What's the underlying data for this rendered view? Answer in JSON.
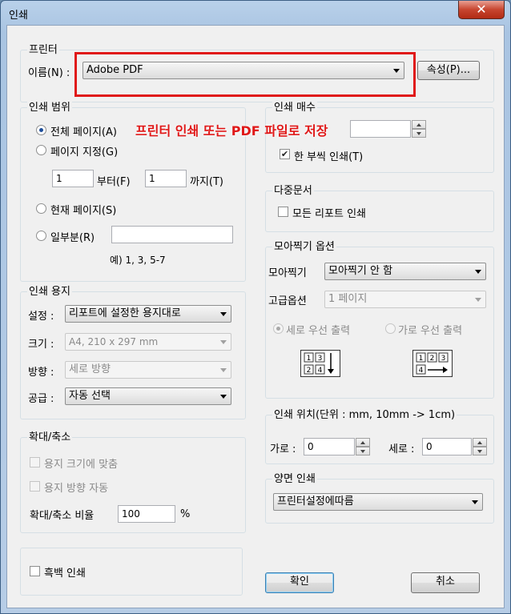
{
  "window": {
    "title": "인쇄",
    "close_glyph": "✕"
  },
  "printer": {
    "group_label": "프린터",
    "name_label": "이름(N) :",
    "name_value": "Adobe PDF",
    "properties_button": "속성(P)..."
  },
  "annotation": {
    "text": "프린터 인쇄 또는 PDF 파일로 저장",
    "color": "#e01818"
  },
  "range": {
    "group_label": "인쇄 범위",
    "all_pages": "전체 페이지(A)",
    "page_range": "페이지 지정(G)",
    "from_value": "1",
    "from_label": "부터(F)",
    "to_value": "1",
    "to_label": "까지(T)",
    "current_page": "현재 페이지(S)",
    "partial": "일부분(R)",
    "partial_value": "",
    "example": "예) 1, 3, 5-7"
  },
  "copies": {
    "group_label": "인쇄 매수",
    "value": "",
    "collate_label": "한 부씩 인쇄(T)",
    "collate_checked": true
  },
  "multi_doc": {
    "group_label": "다중문서",
    "all_reports": "모든 리포트 인쇄",
    "all_reports_checked": false
  },
  "nup": {
    "group_label": "모아찍기 옵션",
    "nup_label": "모아찍기",
    "nup_value": "모아찍기 안 함",
    "advanced_label": "고급옵션",
    "advanced_value": "1 페이지",
    "vertical_first": "세로 우선 출력",
    "horizontal_first": "가로 우선 출력",
    "icon_vertical": [
      "1",
      "3",
      "2",
      "4"
    ],
    "icon_horizontal": [
      "1",
      "2",
      "3",
      "4"
    ]
  },
  "paper": {
    "group_label": "인쇄 용지",
    "setting_label": "설정 :",
    "setting_value": "리포트에 설정한 용지대로",
    "size_label": "크기 :",
    "size_value": "A4, 210 x 297 mm",
    "orientation_label": "방향 :",
    "orientation_value": "세로 방향",
    "source_label": "공급 :",
    "source_value": "자동 선택"
  },
  "position": {
    "group_label": "인쇄 위치(단위 : mm, 10mm -> 1cm)",
    "horizontal_label": "가로 :",
    "horizontal_value": "0",
    "vertical_label": "세로 :",
    "vertical_value": "0"
  },
  "scale": {
    "group_label": "확대/축소",
    "fit_paper": "용지 크기에 맞춤",
    "auto_orientation": "용지 방향 자동",
    "ratio_label": "확대/축소 비율",
    "ratio_value": "100",
    "percent": "%"
  },
  "duplex": {
    "group_label": "양면 인쇄",
    "value": "프린터설정에따름"
  },
  "mono": {
    "label": "흑백 인쇄",
    "checked": false
  },
  "buttons": {
    "ok": "확인",
    "cancel": "취소"
  }
}
